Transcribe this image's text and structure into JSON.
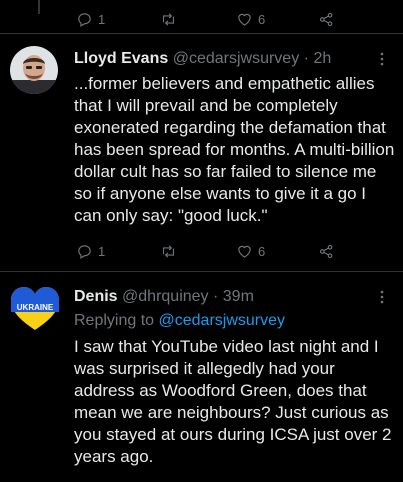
{
  "top_actions": {
    "reply_count": "1",
    "retweet_count": "",
    "like_count": "6"
  },
  "tweet1": {
    "avatar_alt": "Lloyd Evans avatar",
    "name": "Lloyd Evans",
    "handle": "@cedarsjwsurvey",
    "separator": "·",
    "time": "2h",
    "text": "...former believers and empathetic allies that I will prevail and be completely exonerated regarding the defamation that has been spread for months. A multi-billion dollar cult has so far failed to silence me so if anyone else wants to give it a go I can only say: \"good luck.\"",
    "reply_count": "1",
    "retweet_count": "",
    "like_count": "6"
  },
  "tweet2": {
    "avatar_text": "UKRAINE",
    "name": "Denis",
    "handle": "@dhrquiney",
    "separator": "·",
    "time": "39m",
    "replying_prefix": "Replying to",
    "replying_handle": "@cedarsjwsurvey",
    "text": "I saw that YouTube video last night and I was surprised it allegedly had your address as Woodford Green, does that mean we are neighbours? Just curious as you stayed at ours during ICSA just over 2 years ago."
  },
  "colors": {
    "background": "#000000",
    "text": "#e7e9ea",
    "muted": "#71767b",
    "link": "#1d9bf0",
    "divider": "#2f3336"
  },
  "icons": [
    "reply-icon",
    "retweet-icon",
    "like-icon",
    "share-icon",
    "more-icon"
  ]
}
